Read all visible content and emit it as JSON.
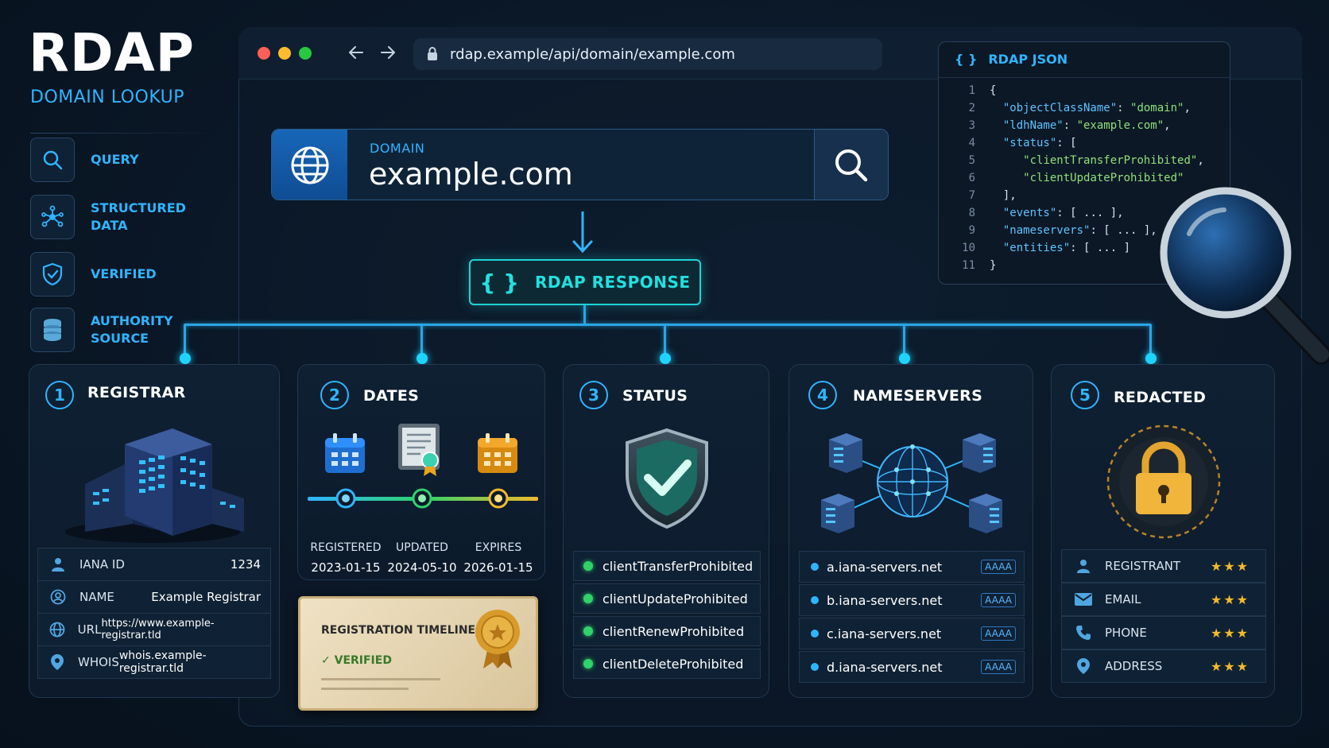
{
  "brand": {
    "title": "RDAP",
    "subtitle": "DOMAIN LOOKUP"
  },
  "sidebar": {
    "items": [
      {
        "label": "QUERY",
        "icon": "search-icon"
      },
      {
        "label": "STRUCTURED\nDATA",
        "icon": "network-icon"
      },
      {
        "label": "VERIFIED",
        "icon": "shield-check-icon"
      },
      {
        "label": "AUTHORITY\nSOURCE",
        "icon": "database-icon"
      }
    ]
  },
  "browser": {
    "url": "rdap.example/api/domain/example.com"
  },
  "search": {
    "label": "DOMAIN",
    "value": "example.com"
  },
  "response": {
    "brace": "{ }",
    "label": "RDAP RESPONSE"
  },
  "json_panel": {
    "brace": "{ }",
    "title": "RDAP JSON",
    "lines": [
      {
        "n": "1",
        "key": "",
        "text": "{"
      },
      {
        "n": "2",
        "key": "\"objectClassName\"",
        "val": "\"domain\"",
        "tail": ","
      },
      {
        "n": "3",
        "key": "\"ldhName\"",
        "val": "\"example.com\"",
        "tail": ","
      },
      {
        "n": "4",
        "key": "\"status\"",
        "val": "",
        "tail": "["
      },
      {
        "n": "5",
        "key": "",
        "val": "\"clientTransferProhibited\"",
        "tail": ","
      },
      {
        "n": "6",
        "key": "",
        "val": "\"clientUpdateProhibited\"",
        "tail": ""
      },
      {
        "n": "7",
        "key": "",
        "text": "  ],"
      },
      {
        "n": "8",
        "key": "\"events\"",
        "val": "",
        "tail": "[ ... ],"
      },
      {
        "n": "9",
        "key": "\"nameservers\"",
        "val": "",
        "tail": "[ ... ],"
      },
      {
        "n": "10",
        "key": "\"entities\"",
        "val": "",
        "tail": "[ ... ]"
      },
      {
        "n": "11",
        "key": "",
        "text": "}"
      }
    ]
  },
  "cards": {
    "registrar": {
      "num": "1",
      "title": "REGISTRAR",
      "rows": [
        {
          "label": "IANA ID",
          "value": "1234",
          "icon": "user-icon"
        },
        {
          "label": "NAME",
          "value": "Example Registrar",
          "icon": "user-circle-icon"
        },
        {
          "label": "URL",
          "value": "https://www.example-registrar.tld",
          "icon": "link-icon"
        },
        {
          "label": "WHOIS",
          "value": "whois.example-registrar.tld",
          "icon": "location-pin-icon"
        }
      ]
    },
    "dates": {
      "num": "2",
      "title": "DATES",
      "events": [
        {
          "label": "REGISTERED",
          "value": "2023-01-15"
        },
        {
          "label": "UPDATED",
          "value": "2024-05-10"
        },
        {
          "label": "EXPIRES",
          "value": "2026-01-15"
        }
      ],
      "certificate": {
        "title": "REGISTRATION TIMELINE",
        "verified": "VERIFIED"
      }
    },
    "status": {
      "num": "3",
      "title": "STATUS",
      "items": [
        "clientTransferProhibited",
        "clientUpdateProhibited",
        "clientRenewProhibited",
        "clientDeleteProhibited"
      ]
    },
    "nameservers": {
      "num": "4",
      "title": "NAMESERVERS",
      "items": [
        {
          "host": "a.iana-servers.net",
          "badge": "AAAA"
        },
        {
          "host": "b.iana-servers.net",
          "badge": "AAAA"
        },
        {
          "host": "c.iana-servers.net",
          "badge": "AAAA"
        },
        {
          "host": "d.iana-servers.net",
          "badge": "AAAA"
        }
      ]
    },
    "redacted": {
      "num": "5",
      "title": "REDACTED",
      "rows": [
        {
          "label": "REGISTRANT",
          "stars": "★★★",
          "icon": "user-icon"
        },
        {
          "label": "EMAIL",
          "stars": "★★★",
          "icon": "mail-icon"
        },
        {
          "label": "PHONE",
          "stars": "★★★",
          "icon": "phone-icon"
        },
        {
          "label": "ADDRESS",
          "stars": "★★★",
          "icon": "location-pin-icon"
        }
      ]
    }
  },
  "colors": {
    "accent": "#2fb4ff",
    "cyan": "#1fd3d6",
    "green": "#2fd36a",
    "gold": "#f2b92e",
    "background": "#0a1726"
  }
}
